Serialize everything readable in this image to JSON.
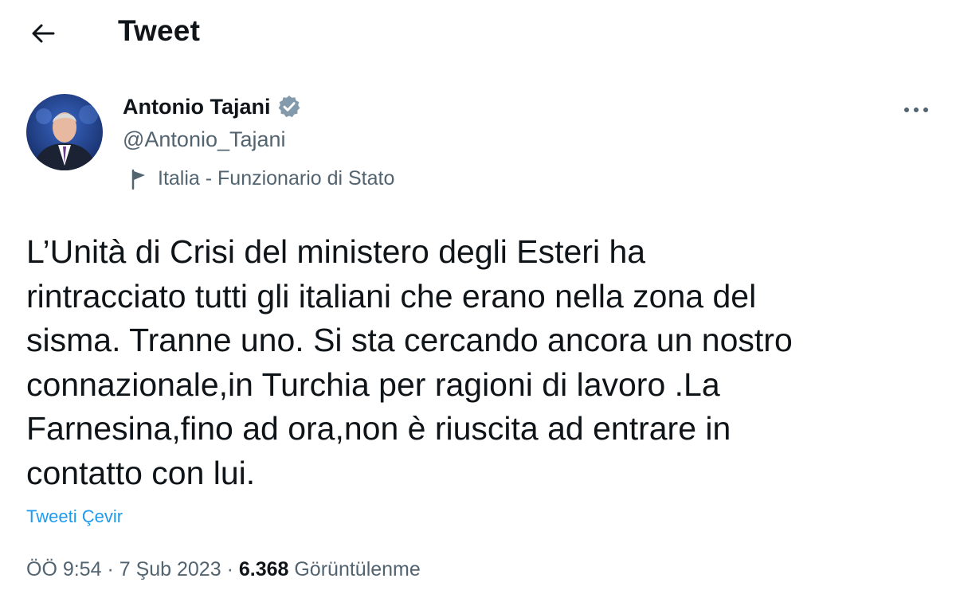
{
  "header": {
    "title": "Tweet",
    "back_icon": "arrow-left-icon"
  },
  "author": {
    "name": "Antonio Tajani",
    "handle": "@Antonio_Tajani",
    "verified_icon": "verified-badge-icon",
    "verified_color": "#829aab",
    "affiliation_icon": "flag-icon",
    "affiliation": "Italia - Funzionario di Stato"
  },
  "more_icon": "more-horizontal-icon",
  "tweet": {
    "text": "L’Unità di Crisi del ministero degli Esteri ha\nrintracciato tutti gli italiani che erano nella zona del\nsisma. Tranne uno. Si sta cercando ancora un nostro\nconnazionale,in Turchia per ragioni di lavoro .La\nFarnesina,fino ad ora,non è riuscita ad entrare in\ncontatto con lui.",
    "translate_label": "Tweeti Çevir"
  },
  "meta": {
    "time": "ÖÖ 9:54",
    "separator": " · ",
    "date": "7 Şub 2023",
    "views_count": "6.368",
    "views_label": "Görüntülenme"
  },
  "colors": {
    "text_primary": "#0f1419",
    "text_secondary": "#536471",
    "link": "#1d9bf0"
  }
}
